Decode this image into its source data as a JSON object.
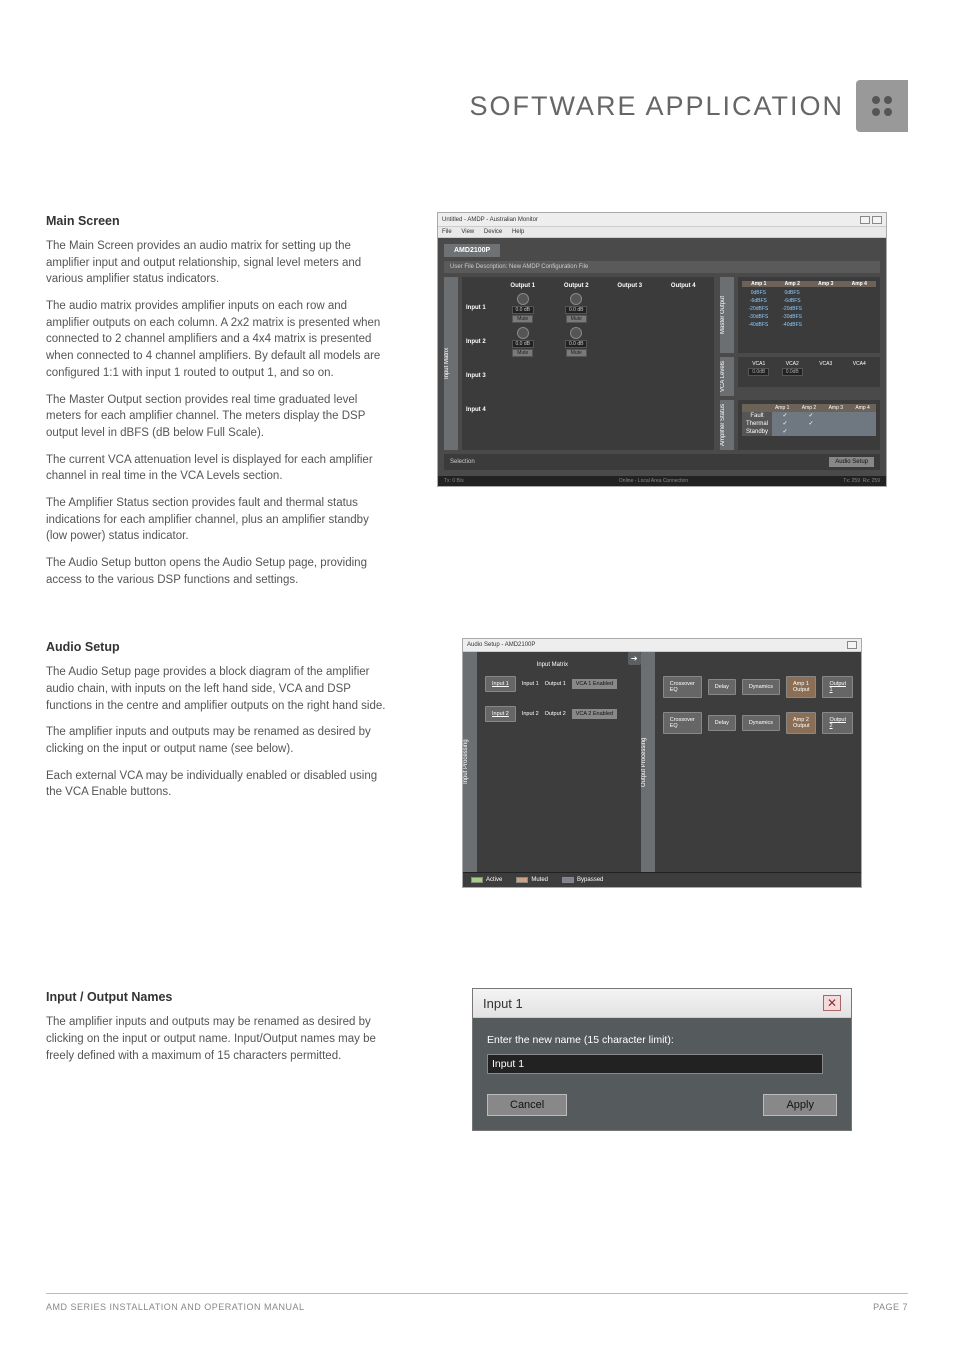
{
  "page_title": "SOFTWARE APPLICATION",
  "footer": {
    "left": "AMD SERIES INSTALLATION AND OPERATION MANUAL",
    "right": "PAGE 7"
  },
  "sections": {
    "main_screen": {
      "heading": "Main Screen",
      "p1": "The Main Screen provides an audio matrix for setting up the amplifier input and output relationship, signal level meters and various amplifier status indicators.",
      "p2": "The audio matrix provides amplifier inputs on each row and amplifier outputs on each column. A 2x2 matrix is presented when connected to 2 channel amplifiers and a 4x4 matrix is presented when connected to 4 channel amplifiers. By default all models are configured 1:1 with input 1 routed to output 1, and so on.",
      "p3": "The Master Output section provides real time graduated level meters for each amplifier channel. The meters display the DSP output level in dBFS (dB below Full Scale).",
      "p4": "The current VCA attenuation level is displayed for each amplifier channel in real time in the VCA Levels section.",
      "p5": "The Amplifier Status section provides fault and thermal status indications for each amplifier channel, plus an amplifier standby (low power) status indicator.",
      "p6": "The Audio Setup button opens the Audio Setup page, providing access to the various  DSP functions and settings."
    },
    "audio_setup": {
      "heading": "Audio Setup",
      "p1": "The Audio Setup page provides a block diagram of the amplifier audio chain, with inputs on the left hand side, VCA and DSP functions in the centre and amplifier outputs on the right hand side.",
      "p2": "The amplifier inputs and outputs may be renamed as desired by clicking on the input or output name (see below).",
      "p3": "Each external VCA may be individually enabled or disabled using the VCA Enable buttons."
    },
    "io_names": {
      "heading": "Input / Output Names",
      "p1": "The amplifier inputs and outputs may be renamed as desired by clicking on the input or output name. Input/Output names may be freely defined with a maximum of 15 characters permitted."
    }
  },
  "main_window": {
    "title": "Untitled - AMDP - Australian Monitor",
    "menu": [
      "File",
      "View",
      "Device",
      "Help"
    ],
    "tab": "AMD2100P",
    "desc_label": "User File Description:",
    "desc_value": "New AMDP Configuration File",
    "vtabs": {
      "input_matrix": "Input Matrix",
      "master_output": "Master Output",
      "vca_levels": "VCA Levels",
      "amp_status": "Amplifier Status"
    },
    "matrix": {
      "outputs": [
        "Output 1",
        "Output 2",
        "Output 3",
        "Output 4"
      ],
      "inputs": [
        "Input 1",
        "Input 2",
        "Input 3",
        "Input 4"
      ],
      "gain": "0.0",
      "gain_unit": "dB",
      "mute": "Mute"
    },
    "master_output": {
      "amps": [
        "Amp 1",
        "Amp 2",
        "Amp 3",
        "Amp 4"
      ],
      "scale": [
        "0dBFS",
        "-6dBFS",
        "-20dBFS",
        "-30dBFS",
        "-40dBFS"
      ]
    },
    "vca": {
      "labels": [
        "VCA1",
        "VCA2",
        "VCA3",
        "VCA4"
      ],
      "value": "0.0dB"
    },
    "amp_status": {
      "amps": [
        "Amp 1",
        "Amp 2",
        "Amp 3",
        "Amp 4"
      ],
      "rows": [
        "Fault",
        "Thermal",
        "Standby"
      ]
    },
    "selection_label": "Selection",
    "audio_setup_btn": "Audio Setup",
    "status_left": "Tx: 0 B/s",
    "status_mid": "Online - Local Area Connection",
    "status_rx1": "Tx: 259",
    "status_rx2": "Rx: 259"
  },
  "audio_setup_window": {
    "title": "Audio Setup - AMD2100P",
    "vtabs": {
      "input_processing": "Input Processing",
      "output_processing": "Output Processing"
    },
    "header_input_matrix": "Input Matrix",
    "rows": [
      {
        "in": "Input 1",
        "inN": "Input 1",
        "out": "Output 1",
        "vca": "VCA 1 Enabled",
        "xover": "Crossover EQ",
        "delay": "Delay",
        "dyn": "Dynamics",
        "amp": "Amp 1 Output",
        "outlink": "Output 1"
      },
      {
        "in": "Input 2",
        "inN": "Input 2",
        "out": "Output 2",
        "vca": "VCA 2 Enabled",
        "xover": "Crossover EQ",
        "delay": "Delay",
        "dyn": "Dynamics",
        "amp": "Amp 2 Output",
        "outlink": "Output 2"
      }
    ],
    "legend": {
      "active": "Active",
      "muted": "Muted",
      "bypassed": "Bypassed"
    }
  },
  "io_dialog": {
    "title": "Input 1",
    "prompt": "Enter the new name (15 character limit):",
    "value": "Input 1",
    "cancel": "Cancel",
    "apply": "Apply"
  }
}
